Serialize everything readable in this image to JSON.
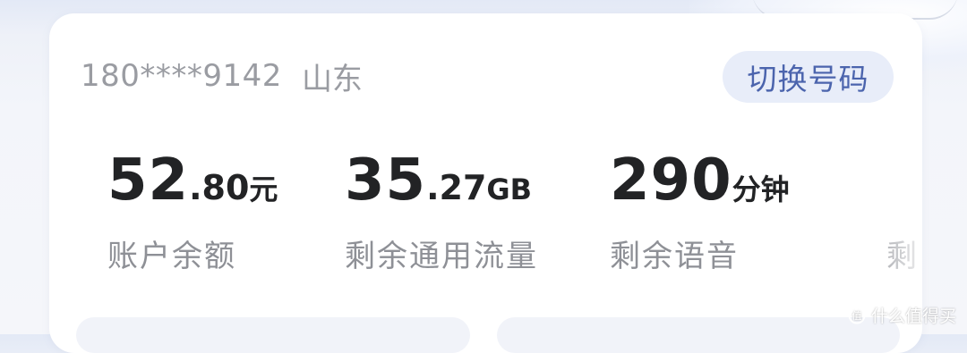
{
  "account": {
    "phone_masked": "180****9142",
    "province": "山东",
    "switch_label": "切换号码"
  },
  "stats": [
    {
      "integer": "52",
      "decimal": ".80",
      "unit": "元",
      "label": "账户余额"
    },
    {
      "integer": "35",
      "decimal": ".27",
      "unit": "GB",
      "label": "剩余通用流量"
    },
    {
      "integer": "290",
      "decimal": "",
      "unit": "分钟",
      "label": "剩余语音"
    },
    {
      "label": "剩"
    }
  ],
  "watermark": {
    "text": "什么值得买",
    "icon": "zhide-logo-icon"
  },
  "colors": {
    "accent": "#4b64ad",
    "accent_bg": "#e8edf9",
    "value_text": "#222325",
    "muted_text": "#8e9096"
  }
}
